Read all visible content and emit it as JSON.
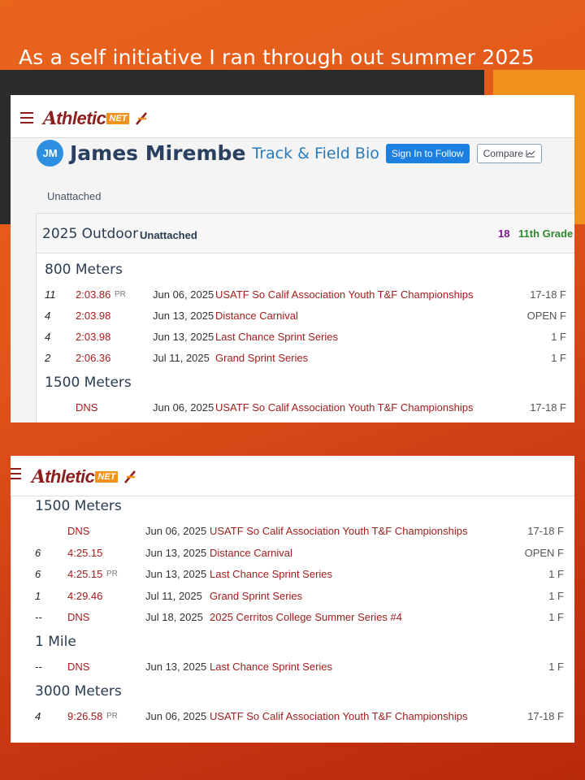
{
  "slide": {
    "title": "As a self initiative I ran through out summer 2025"
  },
  "colors": {
    "brand": "#8d1f1f",
    "accent_orange": "#f0921d",
    "link_blue": "#2b7bbf",
    "follow_button": "#1d7fe0",
    "result_red": "#a31d1d"
  },
  "brand": {
    "logo_mark": "A",
    "logo_text": "thletic",
    "logo_net": "NET"
  },
  "profile": {
    "initials": "JM",
    "name": "James Mirembe",
    "subtitle": "Track & Field Bio",
    "follow_label": "Sign In to Follow",
    "compare_label": "Compare",
    "team": "Unattached"
  },
  "season": {
    "name": "2025 Outdoor",
    "team": "Unattached",
    "age": "18",
    "grade": "11th Grade"
  },
  "shot1": {
    "events": [
      {
        "title": "800 Meters",
        "results": [
          {
            "place": "11",
            "mark": "2:03.86",
            "pr": "PR",
            "date": "Jun 06, 2025",
            "meet": "USATF So Calif Association Youth T&F Championships",
            "division": "17-18 F"
          },
          {
            "place": "4",
            "mark": "2:03.98",
            "pr": "",
            "date": "Jun 13, 2025",
            "meet": "Distance Carnival",
            "division": "OPEN F"
          },
          {
            "place": "4",
            "mark": "2:03.98",
            "pr": "",
            "date": "Jun 13, 2025",
            "meet": "Last Chance Sprint Series",
            "division": "1 F"
          },
          {
            "place": "2",
            "mark": "2:06.36",
            "pr": "",
            "date": "Jul 11, 2025",
            "meet": "Grand Sprint Series",
            "division": "1 F"
          }
        ]
      },
      {
        "title": "1500 Meters",
        "results": [
          {
            "place": "",
            "mark": "DNS",
            "pr": "",
            "date": "Jun 06, 2025",
            "meet": "USATF So Calif Association Youth T&F Championships",
            "division": "17-18 F"
          }
        ]
      }
    ]
  },
  "shot2": {
    "events": [
      {
        "title": "1500 Meters",
        "results": [
          {
            "place": "",
            "mark": "DNS",
            "pr": "",
            "date": "Jun 06, 2025",
            "meet": "USATF So Calif Association Youth T&F Championships",
            "division": "17-18 F"
          },
          {
            "place": "6",
            "mark": "4:25.15",
            "pr": "",
            "date": "Jun 13, 2025",
            "meet": "Distance Carnival",
            "division": "OPEN F"
          },
          {
            "place": "6",
            "mark": "4:25.15",
            "pr": "PR",
            "date": "Jun 13, 2025",
            "meet": "Last Chance Sprint Series",
            "division": "1 F"
          },
          {
            "place": "1",
            "mark": "4:29.46",
            "pr": "",
            "date": "Jul 11, 2025",
            "meet": "Grand Sprint Series",
            "division": "1 F"
          },
          {
            "place": "--",
            "mark": "DNS",
            "pr": "",
            "date": "Jul 18, 2025",
            "meet": "2025 Cerritos College Summer Series #4",
            "division": "1 F"
          }
        ]
      },
      {
        "title": "1 Mile",
        "results": [
          {
            "place": "--",
            "mark": "DNS",
            "pr": "",
            "date": "Jun 13, 2025",
            "meet": "Last Chance Sprint Series",
            "division": "1 F"
          }
        ]
      },
      {
        "title": "3000 Meters",
        "results": [
          {
            "place": "4",
            "mark": "9:26.58",
            "pr": "PR",
            "date": "Jun 06, 2025",
            "meet": "USATF So Calif Association Youth T&F Championships",
            "division": "17-18 F"
          }
        ]
      }
    ]
  }
}
